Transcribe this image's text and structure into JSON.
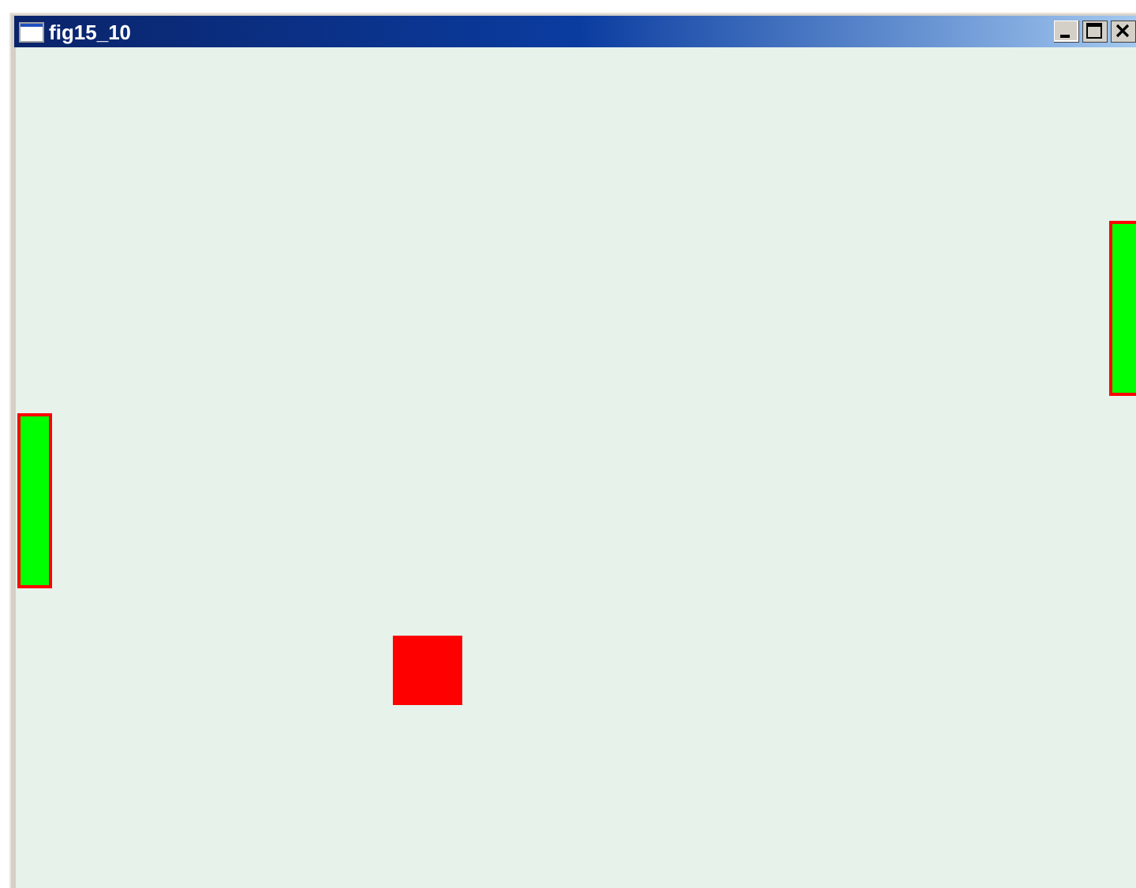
{
  "window": {
    "title": "fig15_10"
  }
}
